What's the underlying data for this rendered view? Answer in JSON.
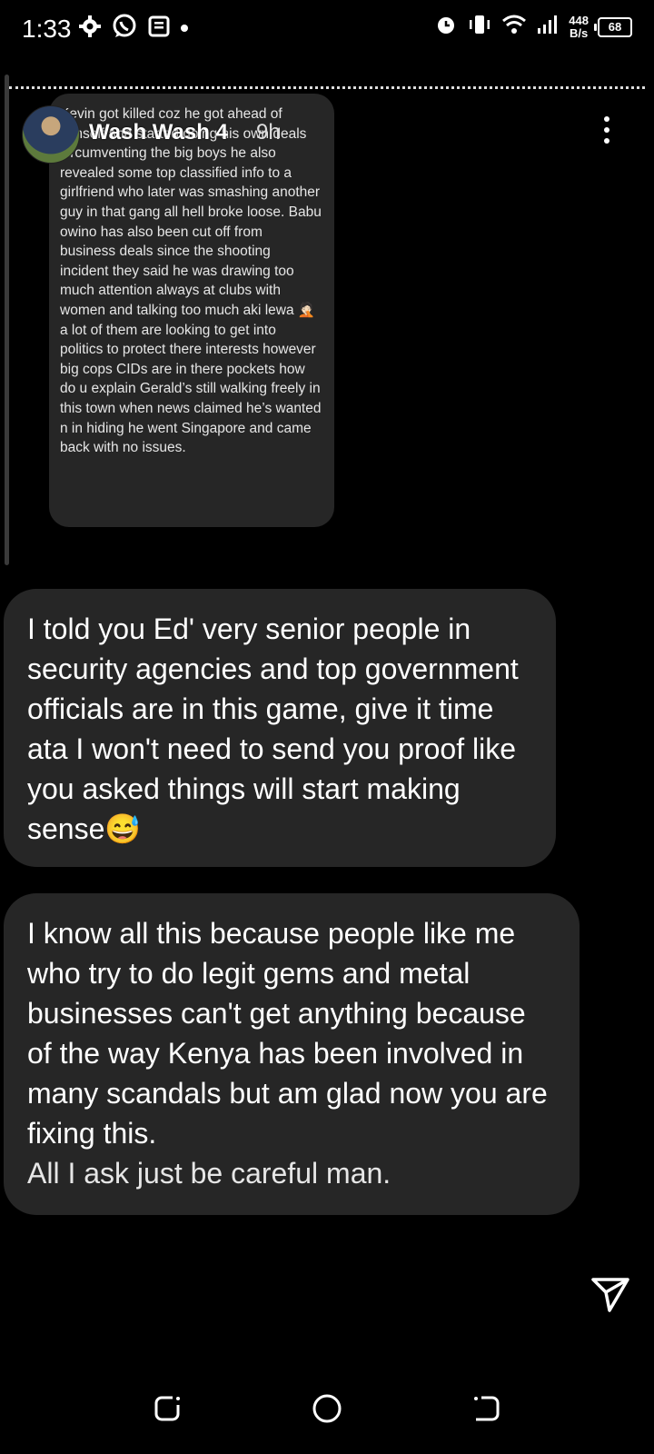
{
  "status_bar": {
    "time": "1:33",
    "net_speed_value": "448",
    "net_speed_unit": "B/s",
    "battery": "68"
  },
  "reply": {
    "username": "Wash Wash 4",
    "time_ago": "9h",
    "quoted_text": "Kevin got killed coz he got ahead of himself and started doing his own deals circumventing the big boys he also revealed some top classified info to a girlfriend who later was smashing another guy in that gang all hell broke loose. Babu owino has also been cut off from business deals since the shooting incident they said he was drawing too much attention always at clubs with women and talking too much aki lewa 🤦🏻 a lot of them are looking to get into politics to protect there interests however big cops CIDs are in there pockets how do u explain Gerald’s still walking freely in this town when news claimed he’s wanted n in hiding he went Singapore and came back with no issues."
  },
  "messages": [
    {
      "text": "I told you Ed' very senior people in security agencies and top government officials are in this game, give it time ata I won't need to send you proof like you asked things will start making sense😅"
    },
    {
      "text": "I know all this because people like me who try to do legit gems and metal businesses can't get anything because of the way Kenya has been involved in many scandals but am glad now you are fixing this.",
      "text2": "All I ask just be careful man."
    }
  ],
  "icons": {
    "settings": "gear-icon",
    "whatsapp": "whatsapp-icon",
    "news": "news-icon",
    "alarm": "alarm-icon",
    "vibrate": "vibrate-icon",
    "wifi": "wifi-icon",
    "signal": "signal-icon",
    "more": "more-vertical-icon",
    "send": "send-icon",
    "recents": "recents-icon",
    "home": "home-icon",
    "back": "back-icon"
  }
}
